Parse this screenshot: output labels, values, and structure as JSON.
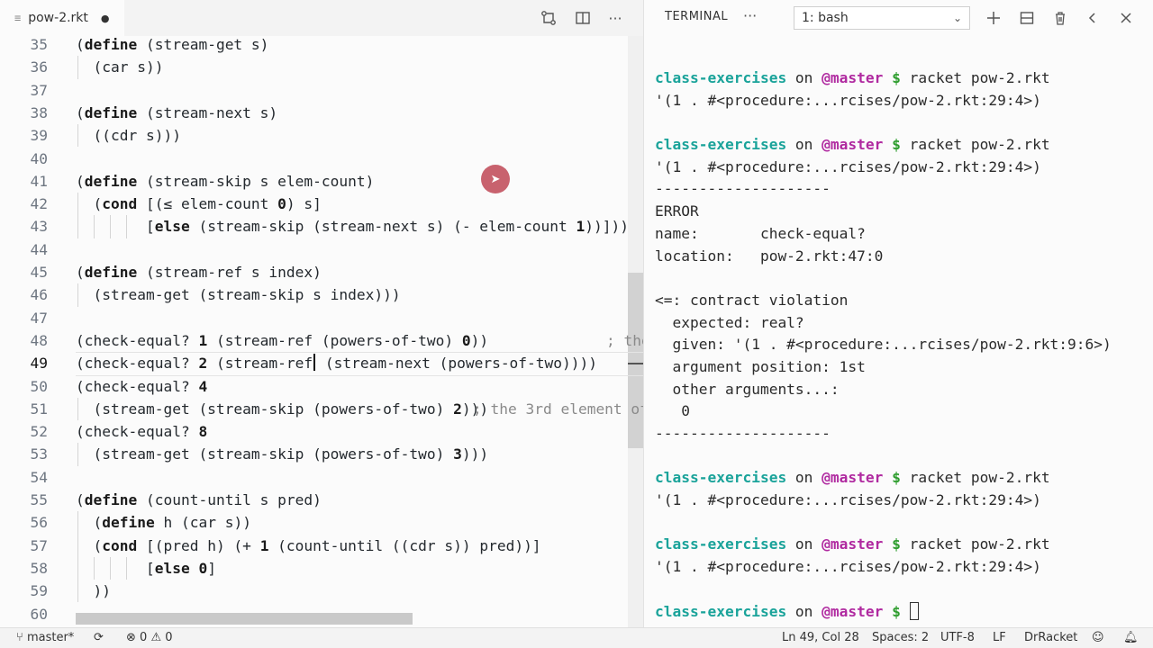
{
  "editor": {
    "tab_label": "pow-2.rkt",
    "tab_modified_dot": "●",
    "comment_48": "; the",
    "comment_51": "; the 3rd element of"
  },
  "code": {
    "lines": [
      {
        "n": "35",
        "text": "(define (stream-get s)"
      },
      {
        "n": "36",
        "text": "  (car s))"
      },
      {
        "n": "37",
        "text": ""
      },
      {
        "n": "38",
        "text": "(define (stream-next s)"
      },
      {
        "n": "39",
        "text": "  ((cdr s)))"
      },
      {
        "n": "40",
        "text": ""
      },
      {
        "n": "41",
        "text": "(define (stream-skip s elem-count)"
      },
      {
        "n": "42",
        "text": "  (cond [(≤ elem-count 0) s]"
      },
      {
        "n": "43",
        "text": "        [else (stream-skip (stream-next s) (- elem-count 1))]))"
      },
      {
        "n": "44",
        "text": ""
      },
      {
        "n": "45",
        "text": "(define (stream-ref s index)"
      },
      {
        "n": "46",
        "text": "  (stream-get (stream-skip s index)))"
      },
      {
        "n": "47",
        "text": ""
      },
      {
        "n": "48",
        "text": "(check-equal? 1 (stream-ref (powers-of-two) 0))"
      },
      {
        "n": "49",
        "text": "(check-equal? 2 (stream-ref (stream-next (powers-of-two))))"
      },
      {
        "n": "50",
        "text": "(check-equal? 4"
      },
      {
        "n": "51",
        "text": "  (stream-get (stream-skip (powers-of-two) 2)))"
      },
      {
        "n": "52",
        "text": "(check-equal? 8"
      },
      {
        "n": "53",
        "text": "  (stream-get (stream-skip (powers-of-two) 3)))"
      },
      {
        "n": "54",
        "text": ""
      },
      {
        "n": "55",
        "text": "(define (count-until s pred)"
      },
      {
        "n": "56",
        "text": "  (define h (car s))"
      },
      {
        "n": "57",
        "text": "  (cond [(pred h) (+ 1 (count-until ((cdr s)) pred))]"
      },
      {
        "n": "58",
        "text": "        [else 0]"
      },
      {
        "n": "59",
        "text": "  ))"
      },
      {
        "n": "60",
        "text": ""
      }
    ]
  },
  "terminal": {
    "title": "TERMINAL",
    "more": "···",
    "selected_shell": "1: bash",
    "lines": [
      {
        "kind": "prompt",
        "dir": "class-exercises",
        "on": " on ",
        "branch": "@master",
        "dollar": " $ ",
        "cmd": "racket pow-2.rkt"
      },
      {
        "kind": "out",
        "text": "'(1 . #<procedure:...rcises/pow-2.rkt:29:4>)"
      },
      {
        "kind": "out",
        "text": ""
      },
      {
        "kind": "prompt",
        "dir": "class-exercises",
        "on": " on ",
        "branch": "@master",
        "dollar": " $ ",
        "cmd": "racket pow-2.rkt"
      },
      {
        "kind": "out",
        "text": "'(1 . #<procedure:...rcises/pow-2.rkt:29:4>)"
      },
      {
        "kind": "out",
        "text": "--------------------"
      },
      {
        "kind": "out",
        "text": "ERROR"
      },
      {
        "kind": "out",
        "text": "name:       check-equal?"
      },
      {
        "kind": "out",
        "text": "location:   pow-2.rkt:47:0"
      },
      {
        "kind": "out",
        "text": ""
      },
      {
        "kind": "out",
        "text": "<=: contract violation"
      },
      {
        "kind": "out",
        "text": "  expected: real?"
      },
      {
        "kind": "out",
        "text": "  given: '(1 . #<procedure:...rcises/pow-2.rkt:9:6>)"
      },
      {
        "kind": "out",
        "text": "  argument position: 1st"
      },
      {
        "kind": "out",
        "text": "  other arguments...:"
      },
      {
        "kind": "out",
        "text": "   0"
      },
      {
        "kind": "out",
        "text": "--------------------"
      },
      {
        "kind": "out",
        "text": ""
      },
      {
        "kind": "prompt",
        "dir": "class-exercises",
        "on": " on ",
        "branch": "@master",
        "dollar": " $ ",
        "cmd": "racket pow-2.rkt"
      },
      {
        "kind": "out",
        "text": "'(1 . #<procedure:...rcises/pow-2.rkt:29:4>)"
      },
      {
        "kind": "out",
        "text": ""
      },
      {
        "kind": "prompt",
        "dir": "class-exercises",
        "on": " on ",
        "branch": "@master",
        "dollar": " $ ",
        "cmd": "racket pow-2.rkt"
      },
      {
        "kind": "out",
        "text": "'(1 . #<procedure:...rcises/pow-2.rkt:29:4>)"
      },
      {
        "kind": "out",
        "text": ""
      },
      {
        "kind": "prompt",
        "dir": "class-exercises",
        "on": " on ",
        "branch": "@master",
        "dollar": " $ ",
        "cmd": "",
        "cursor": true
      }
    ]
  },
  "status": {
    "branch": "master*",
    "errors": "0",
    "warnings": "0",
    "position": "Ln 49, Col 28",
    "spaces": "Spaces: 2",
    "encoding": "UTF-8",
    "eol": "LF",
    "language": "DrRacket"
  },
  "icons": {
    "file": "file-icon",
    "compare": "compare-changes-icon",
    "split": "split-editor-icon",
    "more": "more-actions-icon",
    "add": "add-terminal-icon",
    "split_term": "split-terminal-icon",
    "trash": "trash-icon",
    "chevron_left": "chevron-left-icon",
    "close": "close-icon",
    "branch": "git-branch-icon",
    "sync": "sync-icon",
    "error": "error-icon",
    "warning": "warning-icon",
    "feedback": "feedback-icon",
    "bell": "bell-icon"
  },
  "colors": {
    "dir": "#1aa39a",
    "branch": "#b02aa0",
    "dollar": "#2e9d2e",
    "click_marker": "#be4655"
  }
}
